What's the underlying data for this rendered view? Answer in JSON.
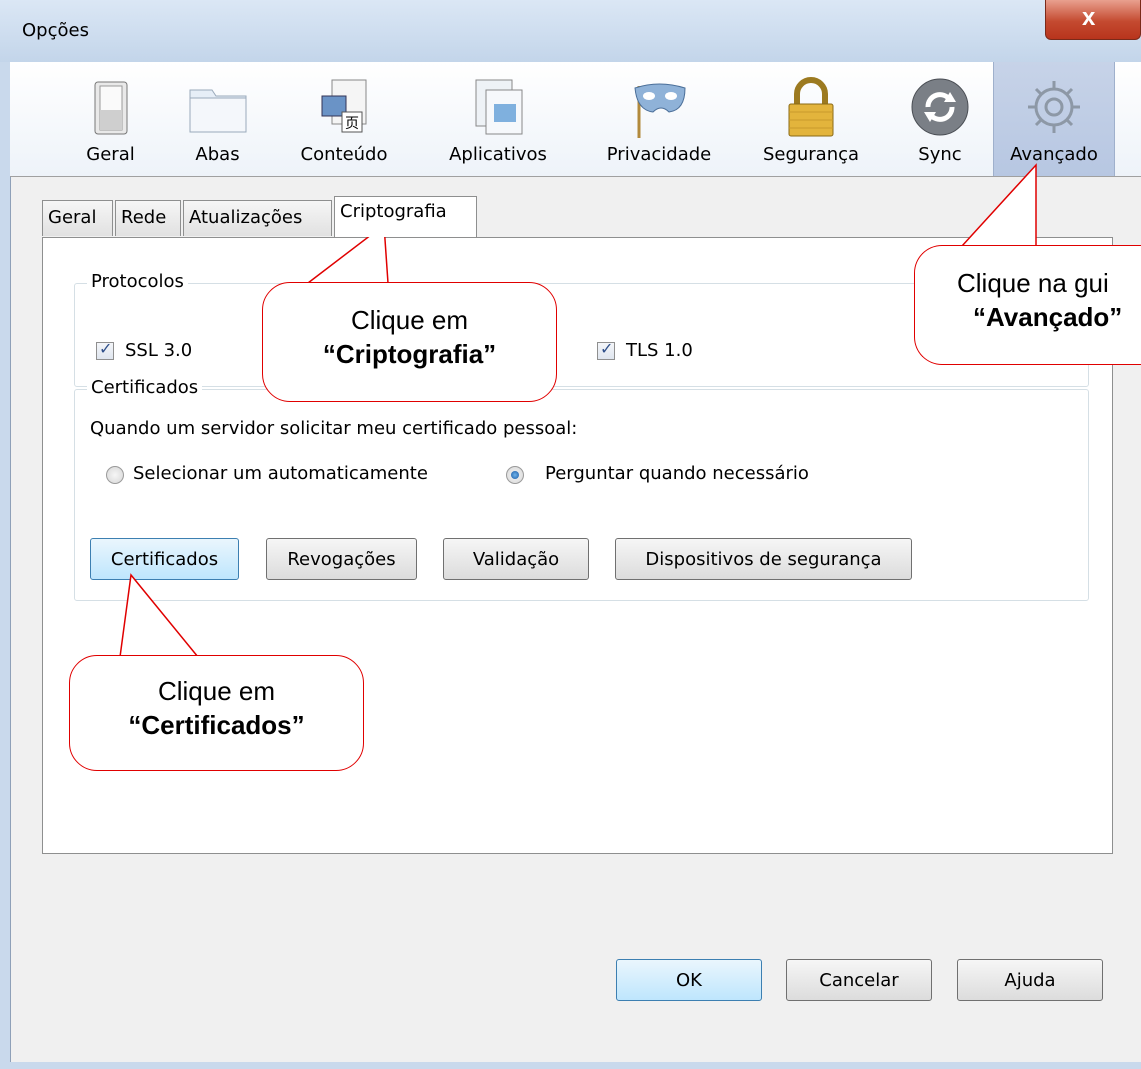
{
  "window": {
    "title": "Opções",
    "close_label": "x"
  },
  "toolbar": {
    "items": [
      {
        "label": "Geral",
        "icon": "switch-icon"
      },
      {
        "label": "Abas",
        "icon": "tabs-folder-icon"
      },
      {
        "label": "Conteúdo",
        "icon": "content-page-icon"
      },
      {
        "label": "Aplicativos",
        "icon": "applications-window-icon"
      },
      {
        "label": "Privacidade",
        "icon": "mask-icon"
      },
      {
        "label": "Segurança",
        "icon": "padlock-icon"
      },
      {
        "label": "Sync",
        "icon": "sync-arrows-icon"
      },
      {
        "label": "Avançado",
        "icon": "gear-icon"
      }
    ],
    "active": "Avançado"
  },
  "tabs": [
    "Geral",
    "Rede",
    "Atualizações",
    "Criptografia"
  ],
  "active_tab": "Criptografia",
  "protocolos": {
    "legend": "Protocolos",
    "ssl_label": "SSL 3.0",
    "tls_label": "TLS 1.0",
    "ssl_checked": true,
    "tls_checked": true
  },
  "certificados": {
    "legend": "Certificados",
    "prompt": "Quando um servidor solicitar meu certificado pessoal:",
    "option_auto": "Selecionar um automaticamente",
    "option_ask": "Perguntar quando necessário",
    "selected": "Perguntar quando necessário",
    "buttons": [
      "Certificados",
      "Revogações",
      "Validação",
      "Dispositivos de segurança"
    ]
  },
  "dialog_buttons": {
    "ok": "OK",
    "cancel": "Cancelar",
    "help": "Ajuda"
  },
  "callouts": {
    "cripto_line1": "Clique em",
    "cripto_line2": "“Criptografia”",
    "avancado_line1": "Clique na gui",
    "avancado_line2": "“Avançado”",
    "cert_line1": "Clique em",
    "cert_line2": "“Certificados”"
  },
  "colors": {
    "callout_border": "#e00000",
    "active_toolbar": "#b7c7e2"
  }
}
